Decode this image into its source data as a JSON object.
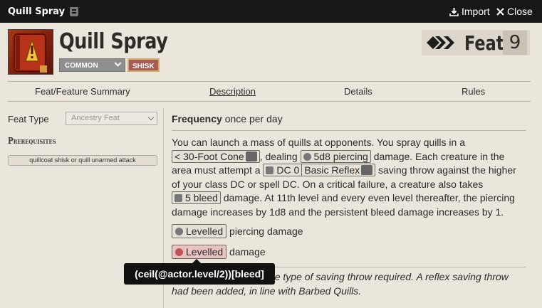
{
  "window": {
    "title": "Quill Spray",
    "import_label": "Import",
    "close_label": "Close"
  },
  "header": {
    "name": "Quill Spray",
    "rarity": "COMMON",
    "trait": "SHISK",
    "item_type": "Feat",
    "level": "9"
  },
  "tabs": [
    {
      "label": "Feat/Feature Summary"
    },
    {
      "label": "Description",
      "active": true
    },
    {
      "label": "Details"
    },
    {
      "label": "Rules"
    }
  ],
  "sidebar": {
    "feat_type_label": "Feat Type",
    "feat_type_value": "Ancestry Feat",
    "prereq_title": "Prerequisites",
    "prereq_tag": "quillcoat shisk or quill unarmed attack"
  },
  "main": {
    "frequency_label": "Frequency",
    "frequency_value": "once per day",
    "desc_1": "You can launch a mass of quills at opponents. You spray quills in a",
    "cone_label": "30-Foot Cone",
    "desc_2": ", dealing",
    "damage_label": "5d8 piercing",
    "desc_3": "damage. Each creature in the area must attempt a",
    "dc_label": "DC 0",
    "save_label": "Basic Reflex",
    "desc_4": "saving throw against the higher of your class DC or spell DC. On a critical failure, a creature also takes",
    "bleed_label": "5 bleed",
    "desc_5": "damage. At 11th level and every even level thereafter, the piercing damage increases by 1d8 and the persistent bleed damage increases by 1.",
    "levelled_1_label": "Levelled",
    "levelled_1_suffix": "piercing damage",
    "levelled_2_label": "Levelled",
    "levelled_2_suffix": "damage",
    "note": "Note: Did not specify the type of saving throw required. A reflex saving throw had been added, in line with Barbed Quills."
  },
  "tooltip": "(ceil(@actor.level/2))[bleed]"
}
